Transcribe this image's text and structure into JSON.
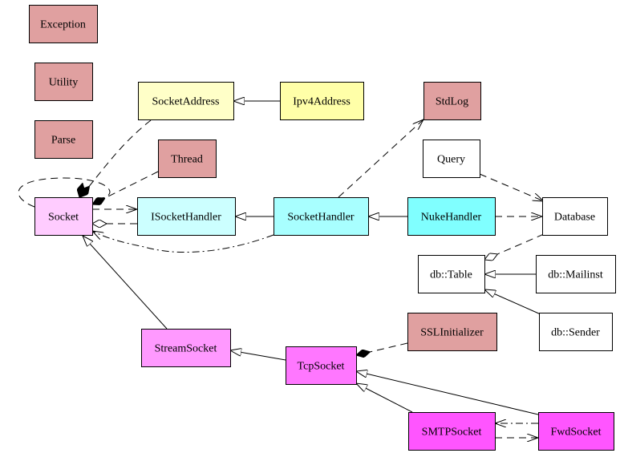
{
  "diagram": {
    "type": "uml-class-diagram",
    "nodes": {
      "exception": {
        "label": "Exception",
        "color": "#e0a0a0"
      },
      "utility": {
        "label": "Utility",
        "color": "#e0a0a0"
      },
      "parse": {
        "label": "Parse",
        "color": "#e0a0a0"
      },
      "socketaddress": {
        "label": "SocketAddress",
        "color": "#ffffc8"
      },
      "ipv4address": {
        "label": "Ipv4Address",
        "color": "#ffffa8"
      },
      "stdlog": {
        "label": "StdLog",
        "color": "#e0a0a0"
      },
      "thread": {
        "label": "Thread",
        "color": "#e0a0a0"
      },
      "query": {
        "label": "Query",
        "color": "#ffffff"
      },
      "socket": {
        "label": "Socket",
        "color": "#ffccff"
      },
      "isockethandler": {
        "label": "ISocketHandler",
        "color": "#ccffff"
      },
      "sockethandler": {
        "label": "SocketHandler",
        "color": "#a8ffff"
      },
      "nukehandler": {
        "label": "NukeHandler",
        "color": "#80ffff"
      },
      "database": {
        "label": "Database",
        "color": "#ffffff"
      },
      "dbtable": {
        "label": "db::Table",
        "color": "#ffffff"
      },
      "dbmailinst": {
        "label": "db::Mailinst",
        "color": "#ffffff"
      },
      "dbsender": {
        "label": "db::Sender",
        "color": "#ffffff"
      },
      "sslinitializer": {
        "label": "SSLInitializer",
        "color": "#e0a0a0"
      },
      "streamsocket": {
        "label": "StreamSocket",
        "color": "#ff99ff"
      },
      "tcpsocket": {
        "label": "TcpSocket",
        "color": "#ff77ff"
      },
      "smtpsocket": {
        "label": "SMTPSocket",
        "color": "#ff55ff"
      },
      "fwdsocket": {
        "label": "FwdSocket",
        "color": "#ff55ff"
      }
    },
    "edges": [
      {
        "from": "Ipv4Address",
        "to": "SocketAddress",
        "kind": "generalization"
      },
      {
        "from": "SocketHandler",
        "to": "ISocketHandler",
        "kind": "generalization"
      },
      {
        "from": "NukeHandler",
        "to": "SocketHandler",
        "kind": "generalization"
      },
      {
        "from": "db::Mailinst",
        "to": "db::Table",
        "kind": "generalization"
      },
      {
        "from": "db::Sender",
        "to": "db::Table",
        "kind": "generalization"
      },
      {
        "from": "StreamSocket",
        "to": "Socket",
        "kind": "generalization"
      },
      {
        "from": "TcpSocket",
        "to": "StreamSocket",
        "kind": "generalization"
      },
      {
        "from": "SMTPSocket",
        "to": "TcpSocket",
        "kind": "generalization"
      },
      {
        "from": "FwdSocket",
        "to": "TcpSocket",
        "kind": "generalization"
      },
      {
        "from": "Socket",
        "to": "Socket",
        "kind": "composition"
      },
      {
        "from": "SocketAddress",
        "to": "Socket",
        "kind": "composition"
      },
      {
        "from": "Thread",
        "to": "Socket",
        "kind": "composition"
      },
      {
        "from": "Socket",
        "to": "ISocketHandler",
        "kind": "dependency"
      },
      {
        "from": "ISocketHandler",
        "to": "Socket",
        "kind": "aggregation"
      },
      {
        "from": "SocketHandler",
        "to": "Socket",
        "kind": "dependency-dashdot"
      },
      {
        "from": "SocketHandler",
        "to": "StdLog",
        "kind": "dependency"
      },
      {
        "from": "Query",
        "to": "Database",
        "kind": "dependency"
      },
      {
        "from": "NukeHandler",
        "to": "Database",
        "kind": "dependency"
      },
      {
        "from": "Database",
        "to": "db::Table",
        "kind": "aggregation"
      },
      {
        "from": "SSLInitializer",
        "to": "TcpSocket",
        "kind": "composition"
      },
      {
        "from": "FwdSocket",
        "to": "SMTPSocket",
        "kind": "dependency-dashdot"
      },
      {
        "from": "SMTPSocket",
        "to": "FwdSocket",
        "kind": "dependency"
      }
    ]
  }
}
